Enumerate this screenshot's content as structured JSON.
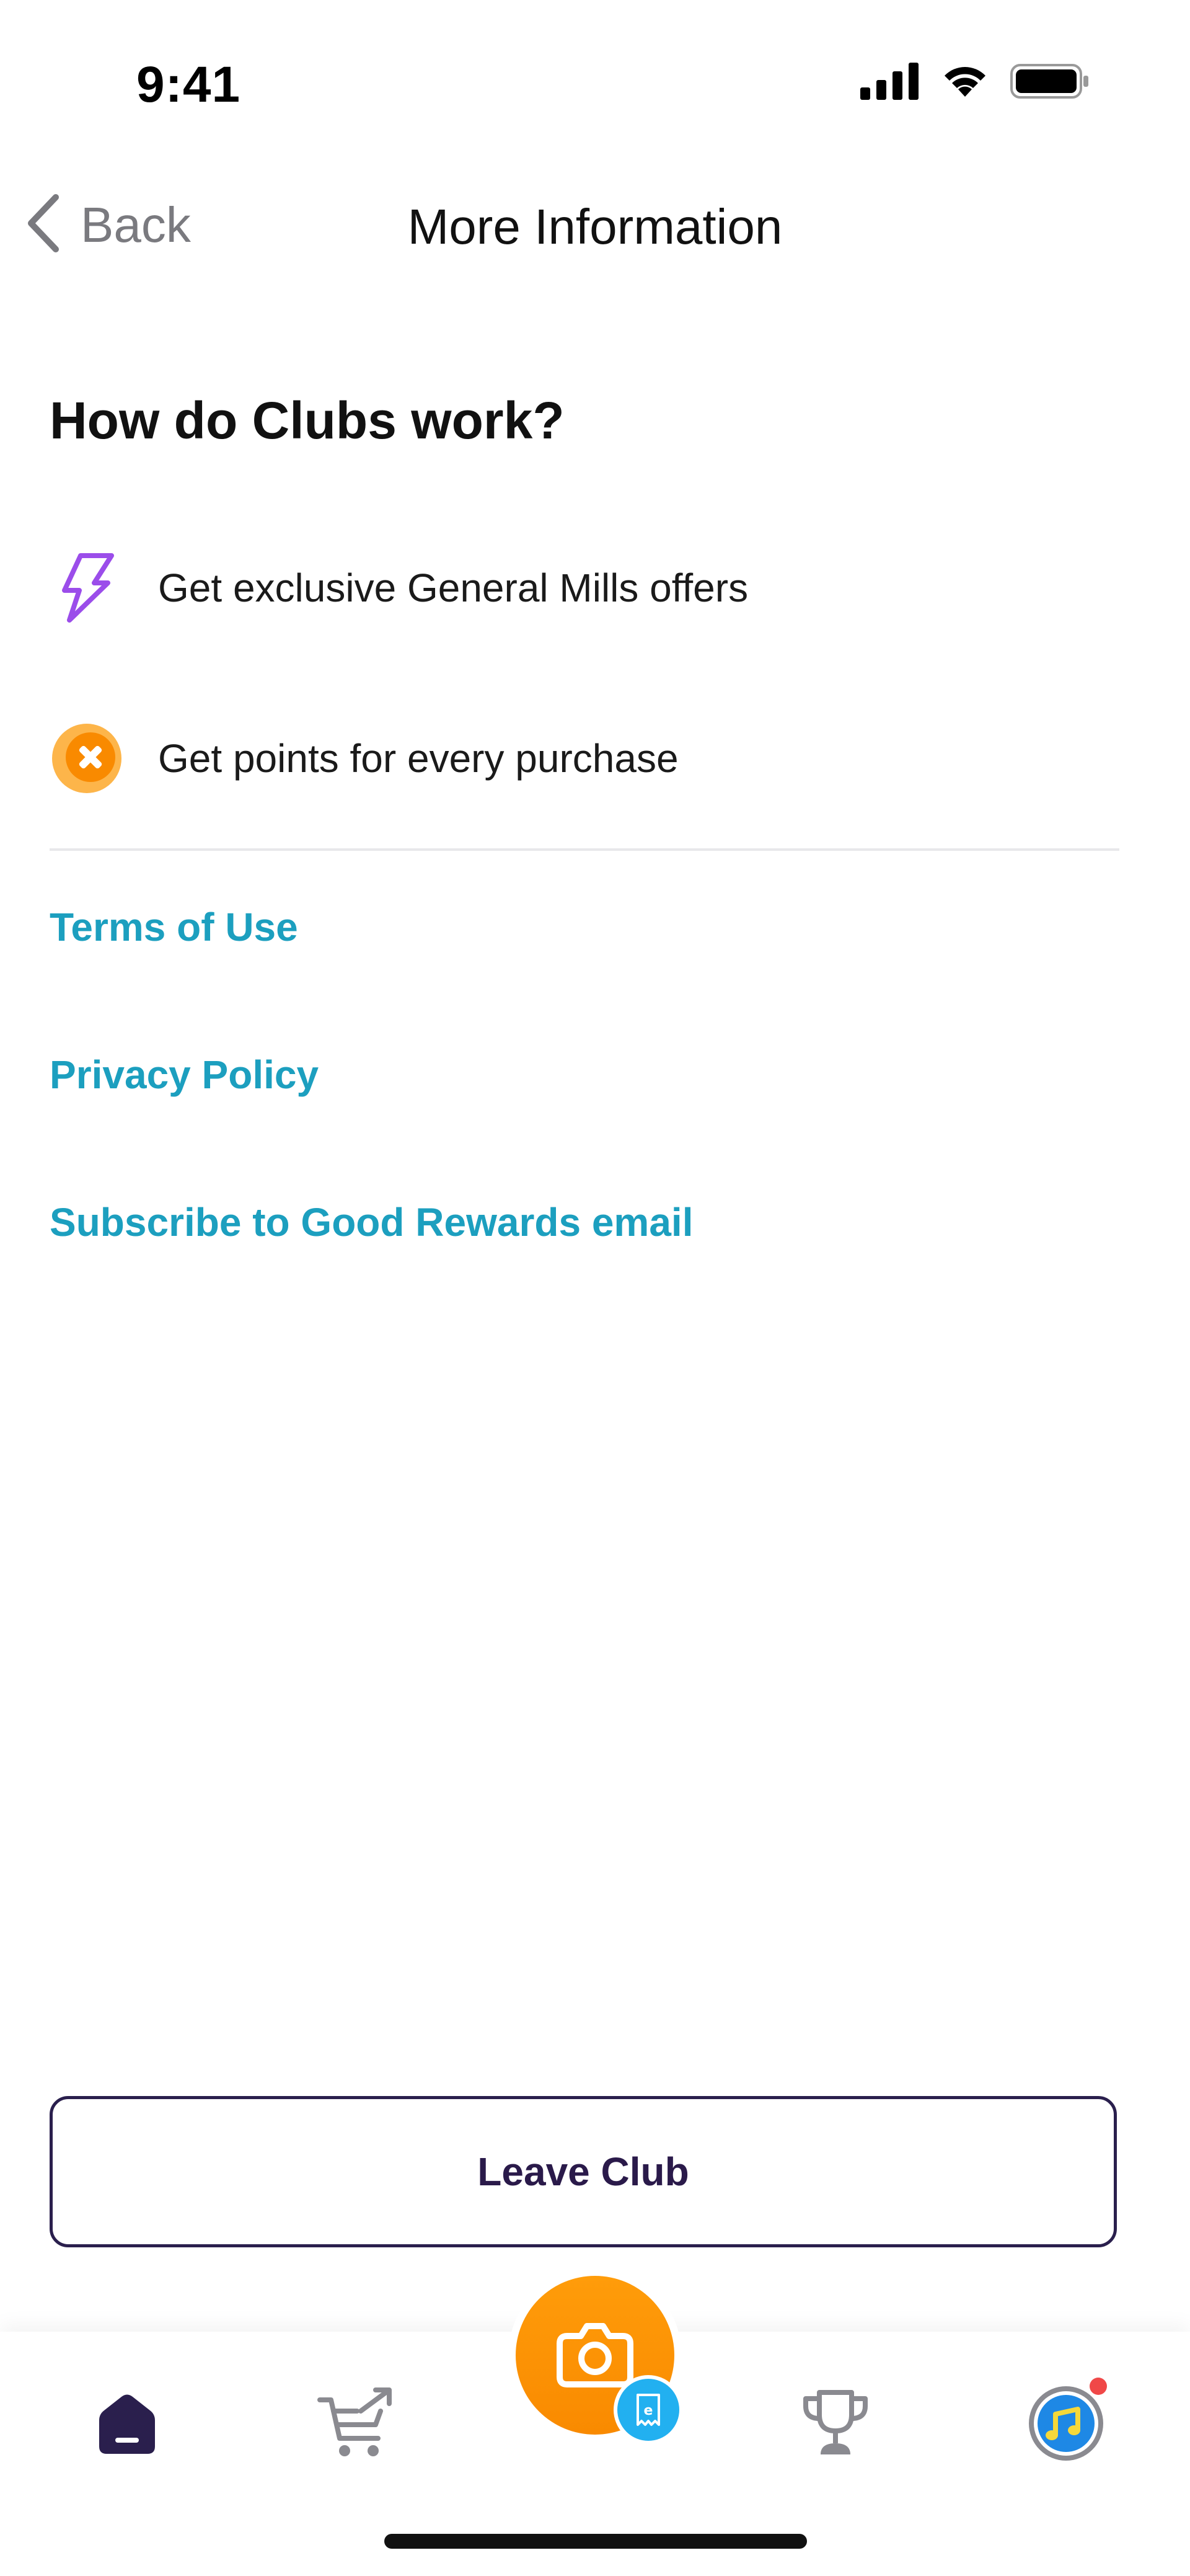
{
  "status_bar": {
    "time": "9:41"
  },
  "nav": {
    "back_label": "Back",
    "title": "More Information"
  },
  "section": {
    "title": "How do Clubs work?"
  },
  "features": [
    {
      "label": "Get exclusive General Mills offers",
      "icon": "lightning-icon"
    },
    {
      "label": "Get points for every purchase",
      "icon": "points-coin-icon"
    }
  ],
  "links": {
    "terms": "Terms of Use",
    "privacy": "Privacy Policy",
    "subscribe": "Subscribe to Good Rewards email"
  },
  "actions": {
    "leave_club": "Leave Club"
  },
  "tab_bar": {
    "items": [
      "home-icon",
      "cart-share-icon",
      "camera-icon",
      "trophy-icon",
      "profile-avatar-icon"
    ],
    "notification_dot": true
  },
  "colors": {
    "link": "#1c9fbf",
    "accent_orange": "#f98a00",
    "button_border": "#2a1f4d",
    "lightning": "#9b4dea"
  }
}
